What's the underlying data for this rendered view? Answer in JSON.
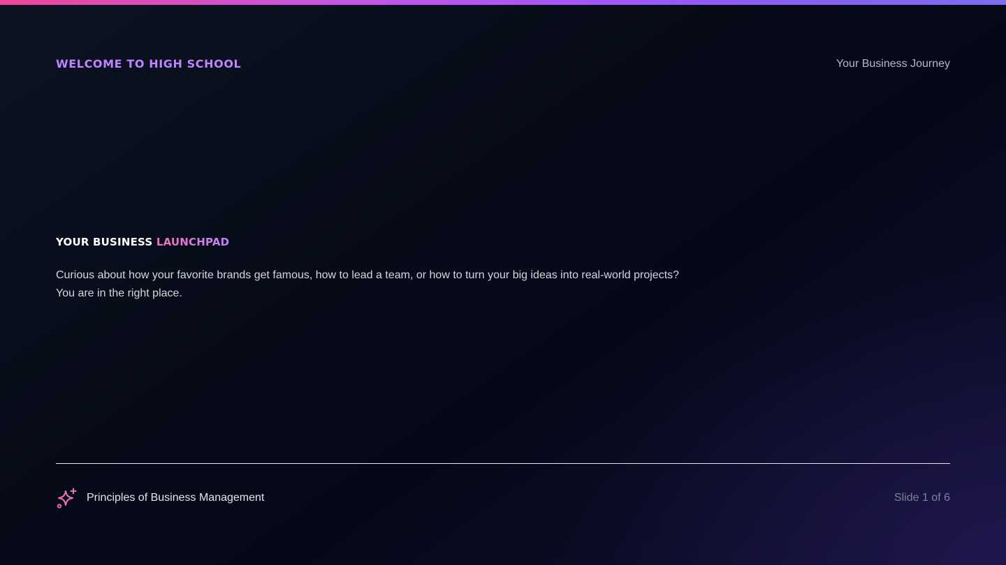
{
  "header": {
    "kicker": "WELCOME TO HIGH SCHOOL",
    "journey": "Your Business Journey"
  },
  "hero": {
    "title_main": "YOUR BUSINESS",
    "title_accent": "LAUNCHPAD",
    "intro": "Curious about how your favorite brands get famous, how to lead a team, or how to turn your big ideas into real-world projects? You are in the right place."
  },
  "footer": {
    "icon": "sparkle-icon",
    "course": "Principles of Business Management",
    "slide_counter": "Slide 1 of 6"
  },
  "colors": {
    "accent_purple": "#c084fc",
    "accent_pink": "#f472b6",
    "background": "#070b18"
  }
}
